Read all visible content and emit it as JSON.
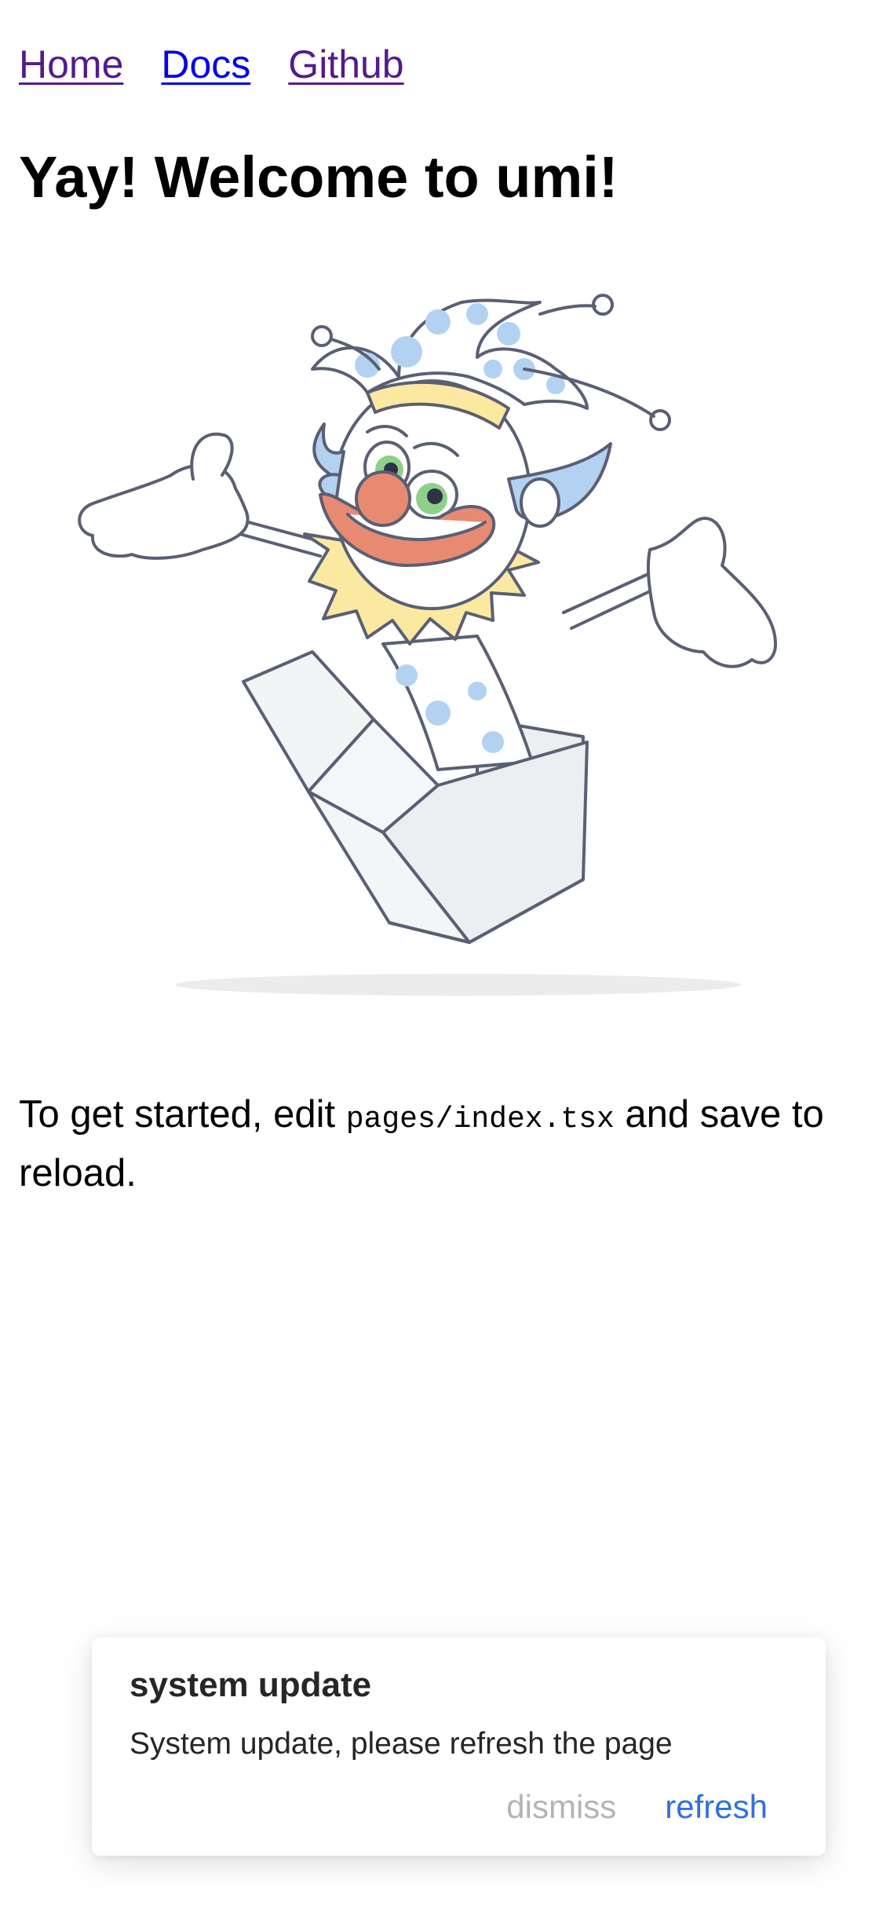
{
  "nav": {
    "links": [
      {
        "label": "Home"
      },
      {
        "label": "Docs"
      },
      {
        "label": "Github"
      }
    ]
  },
  "page_title": "Yay! Welcome to umi!",
  "illustration": {
    "icon": "clown-in-box-illustration"
  },
  "intro": {
    "before": "To get started, edit ",
    "code": "pages/index.tsx",
    "after": " and save to reload."
  },
  "notification": {
    "title": "system update",
    "message": "System update, please refresh the page",
    "dismiss_label": "dismiss",
    "refresh_label": "refresh"
  },
  "colors": {
    "link_visited": "#551a8b",
    "link_unvisited": "#0000ee",
    "refresh_action": "#2f6fe4",
    "dismiss_action": "#b4b4b4",
    "clown_blue": "#b3d2f2",
    "clown_yellow": "#fbe9a1",
    "clown_nose": "#e88a71"
  }
}
